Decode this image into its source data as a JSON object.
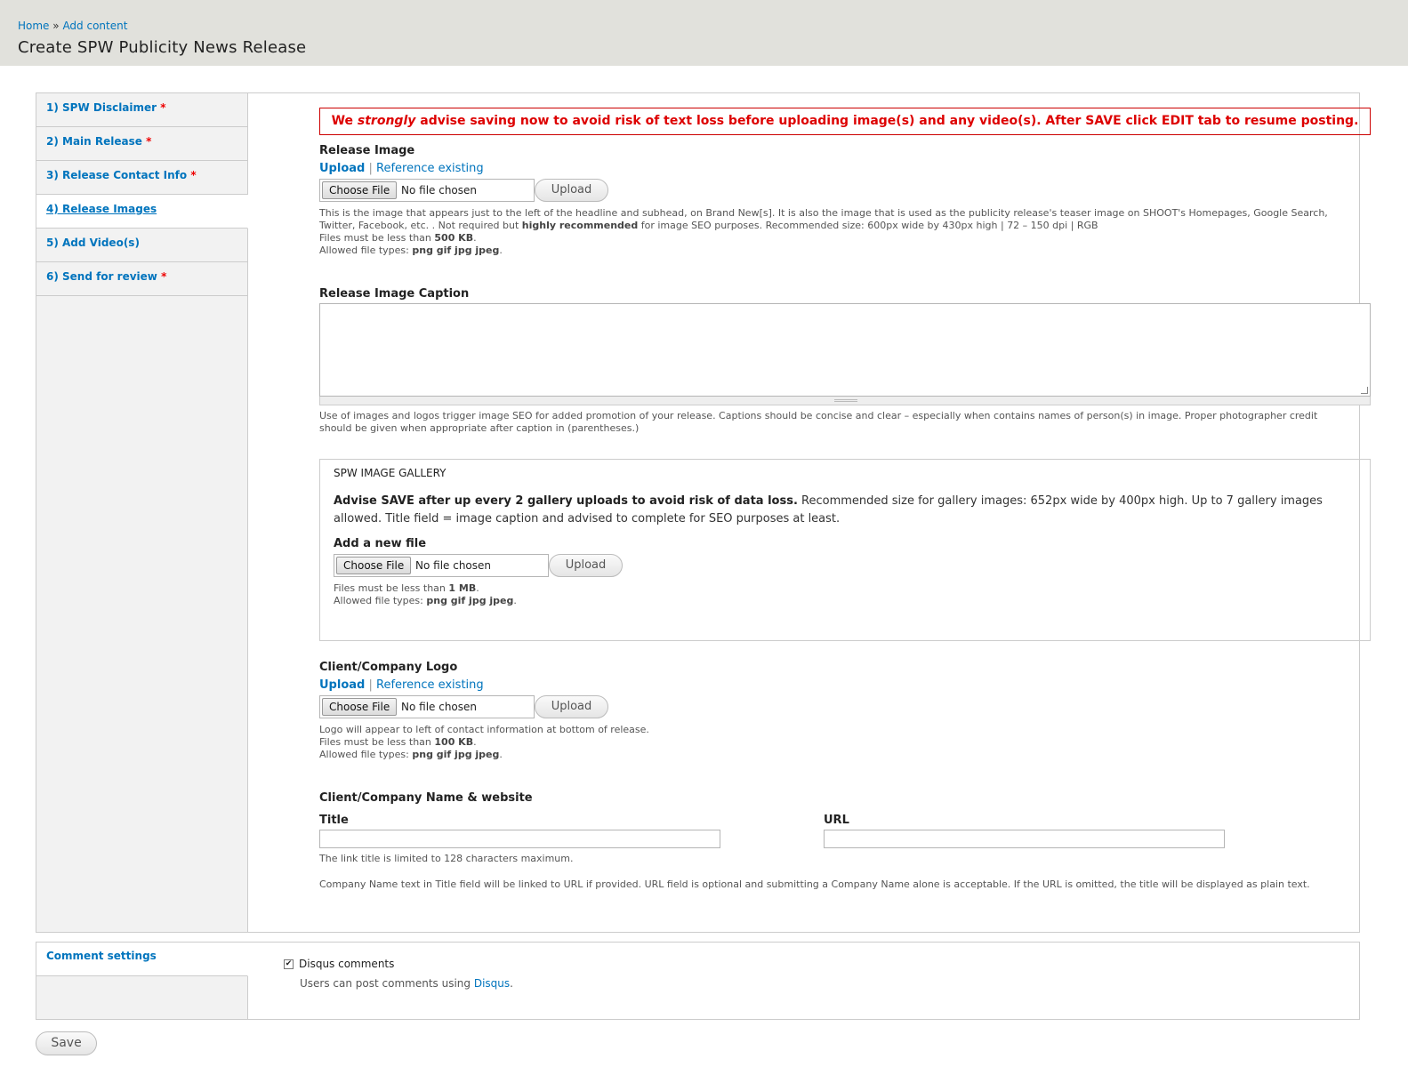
{
  "breadcrumb": {
    "home": "Home",
    "sep": "»",
    "add_content": "Add content"
  },
  "page_title": "Create SPW Publicity News Release",
  "tabs": [
    {
      "label": "1) SPW Disclaimer",
      "required": "*"
    },
    {
      "label": "2) Main Release",
      "required": "*"
    },
    {
      "label": "3) Release Contact Info",
      "required": "*"
    },
    {
      "label": "4) Release Images",
      "required": ""
    },
    {
      "label": "5) Add Video(s)",
      "required": ""
    },
    {
      "label": "6) Send for review",
      "required": "*"
    }
  ],
  "warning": {
    "pre": "We ",
    "em": "strongly",
    "post": " advise saving now to avoid risk of text loss before uploading image(s) and any video(s). After SAVE click EDIT tab to resume posting."
  },
  "release_image": {
    "label": "Release Image",
    "upload_link": "Upload",
    "sep": "|",
    "reference_link": "Reference existing",
    "choose_file": "Choose File",
    "no_file": "No file chosen",
    "upload_button": "Upload",
    "desc1": "This is the image that appears just to the left of the headline and subhead, on Brand New[s]. It is also the image that is used as the publicity release's teaser image on SHOOT's Homepages, Google Search,",
    "desc2_a": "Twitter, Facebook, etc. . Not required but ",
    "desc2_b": "highly recommended",
    "desc2_c": " for image SEO purposes. Recommended size: 600px wide by 430px high | 72 – 150 dpi | RGB",
    "size_pre": "Files must be less than ",
    "size_val": "500 KB",
    "size_post": ".",
    "types_pre": "Allowed file types: ",
    "types_val": "png gif jpg jpeg",
    "types_post": "."
  },
  "caption": {
    "label": "Release Image Caption",
    "desc1": "Use of images and logos trigger image SEO for added promotion of your release. Captions should be concise and clear – especially when contains names of person(s) in image. Proper photographer credit",
    "desc2": "should be given when appropriate after caption in (parentheses.)"
  },
  "gallery": {
    "legend": "SPW IMAGE GALLERY",
    "advise_bold": "Advise SAVE after up every 2 gallery uploads to avoid risk of data loss.",
    "advise_rest": " Recommended size for gallery images: 652px wide by 400px high. Up to 7 gallery images allowed. Title field = image caption and advised to complete for SEO purposes at least.",
    "add_label": "Add a new file",
    "choose_file": "Choose File",
    "no_file": "No file chosen",
    "upload_button": "Upload",
    "size_pre": "Files must be less than ",
    "size_val": "1 MB",
    "size_post": ".",
    "types_pre": "Allowed file types: ",
    "types_val": "png gif jpg jpeg",
    "types_post": "."
  },
  "logo": {
    "label": "Client/Company Logo",
    "upload_link": "Upload",
    "sep": "|",
    "reference_link": "Reference existing",
    "choose_file": "Choose File",
    "no_file": "No file chosen",
    "upload_button": "Upload",
    "desc1": "Logo will appear to left of contact information at bottom of release.",
    "size_pre": "Files must be less than ",
    "size_val": "100 KB",
    "size_post": ".",
    "types_pre": "Allowed file types: ",
    "types_val": "png gif jpg jpeg",
    "types_post": "."
  },
  "company": {
    "label": "Client/Company Name & website",
    "title_label": "Title",
    "url_label": "URL",
    "title_value": "",
    "url_value": "",
    "limit_note": "The link title is limited to 128 characters maximum.",
    "note": "Company Name text in Title field will be linked to URL if provided. URL field is optional and submitting a Company Name alone is acceptable. If the URL is omitted, the title will be displayed as plain text."
  },
  "comments": {
    "tab": "Comment settings",
    "checkbox_checked": "✔",
    "checkbox_label": "Disqus comments",
    "desc_pre": "Users can post comments using ",
    "desc_link": "Disqus",
    "desc_post": "."
  },
  "save_button": "Save"
}
